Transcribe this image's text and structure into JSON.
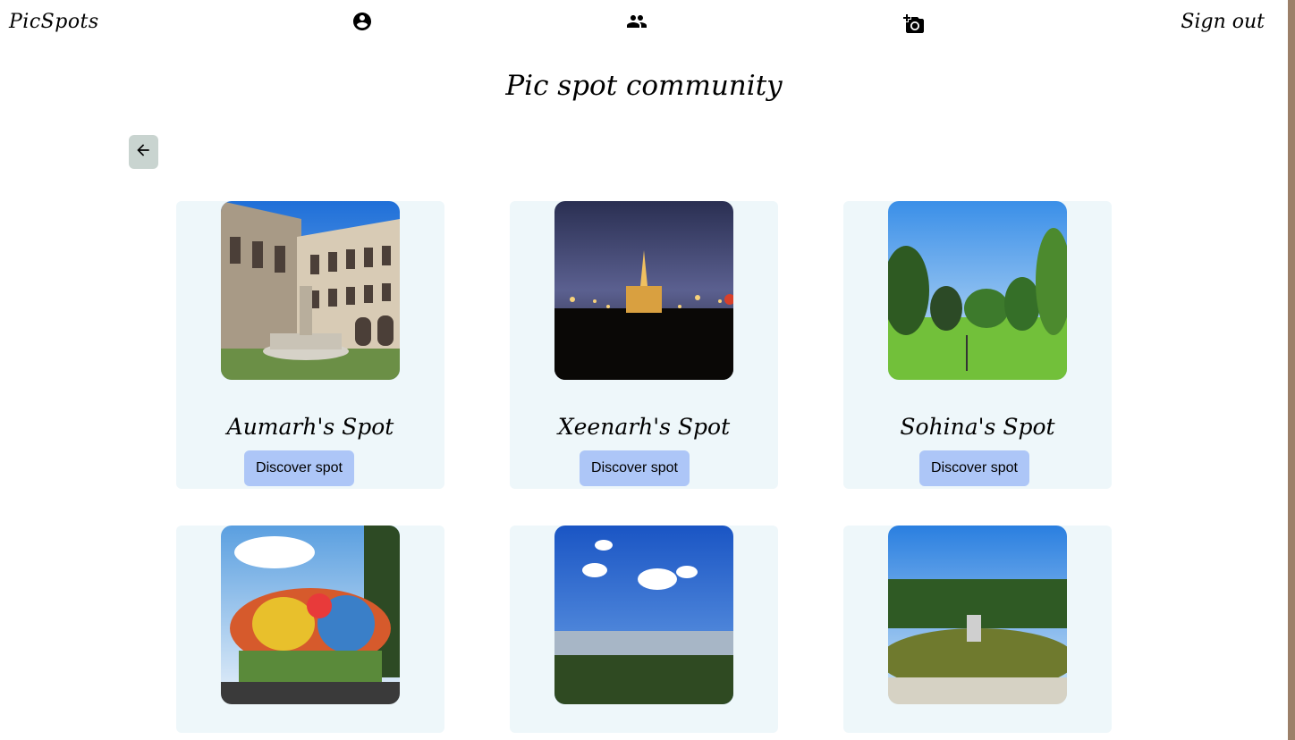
{
  "header": {
    "brand": "PicSpots",
    "sign_out": "Sign out",
    "nav": [
      {
        "icon": "account-circle-icon"
      },
      {
        "icon": "people-icon"
      },
      {
        "icon": "add-photo-icon"
      }
    ]
  },
  "page": {
    "title": "Pic spot community",
    "back_icon": "arrow-left-icon"
  },
  "spots": [
    {
      "name": "Aumarh's Spot",
      "button": "Discover spot",
      "photo": "ornate palace courtyard with fountain"
    },
    {
      "name": "Xeenarh's Spot",
      "button": "Discover spot",
      "photo": "city hall at night"
    },
    {
      "name": "Sohina's Spot",
      "button": "Discover spot",
      "photo": "green park with trees"
    },
    {
      "name": "",
      "button": "",
      "photo": "colorful fairground ride"
    },
    {
      "name": "",
      "button": "",
      "photo": "city view from hill with clouds"
    },
    {
      "name": "",
      "button": "",
      "photo": "fountain pond in garden"
    }
  ],
  "colors": {
    "card_bg": "#eef7fa",
    "button_bg": "#adc6f7",
    "back_button_bg": "#c9d4d0"
  }
}
